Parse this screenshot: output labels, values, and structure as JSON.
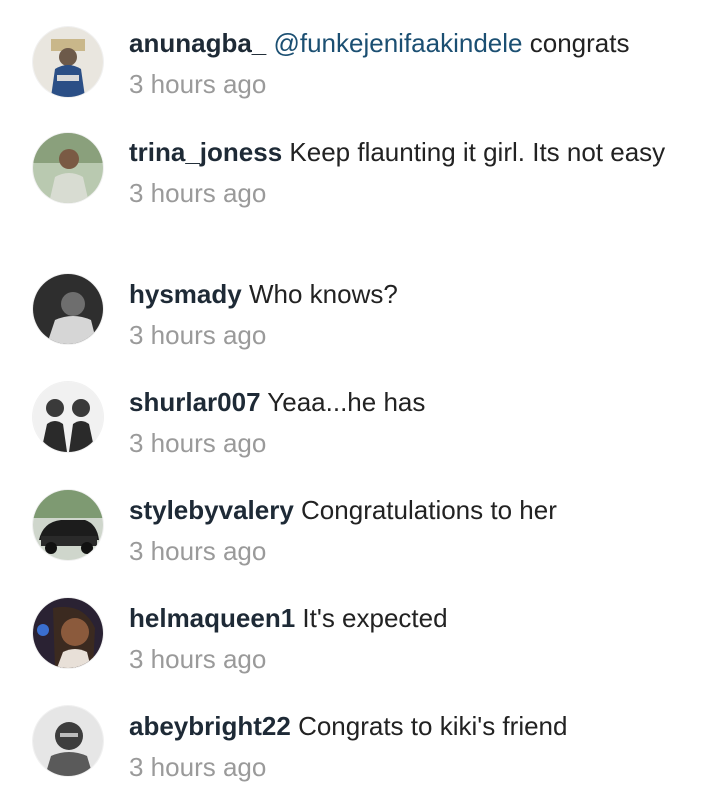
{
  "comments": [
    {
      "username": "anunagba_",
      "mention": "@funkejenifaakindele",
      "text": "congrats",
      "time": "3 hours ago",
      "avatar_icon": "user-avatar-photo"
    },
    {
      "username": "trina_joness",
      "mention": "",
      "text": "Keep flaunting it girl. Its not easy",
      "time": "3 hours ago",
      "avatar_icon": "user-avatar-photo"
    },
    {
      "username": "hysmady",
      "mention": "",
      "text": "Who knows?",
      "time": "3 hours ago",
      "avatar_icon": "user-avatar-photo"
    },
    {
      "username": "shurlar007",
      "mention": "",
      "text": "Yeaa...he has",
      "time": "3 hours ago",
      "avatar_icon": "user-avatar-photo"
    },
    {
      "username": "stylebyvalery",
      "mention": "",
      "text": "Congratulations to her",
      "time": "3 hours ago",
      "avatar_icon": "user-avatar-photo"
    },
    {
      "username": "helmaqueen1",
      "mention": "",
      "text": "It's expected",
      "time": "3 hours ago",
      "avatar_icon": "user-avatar-photo"
    },
    {
      "username": "abeybright22",
      "mention": "",
      "text": "Congrats to kiki's friend",
      "time": "3 hours ago",
      "avatar_icon": "user-avatar-photo"
    }
  ],
  "colors": {
    "username": "#1e2a36",
    "mention": "#1b4f72",
    "timestamp": "#9a9a9a",
    "text": "#222222"
  }
}
